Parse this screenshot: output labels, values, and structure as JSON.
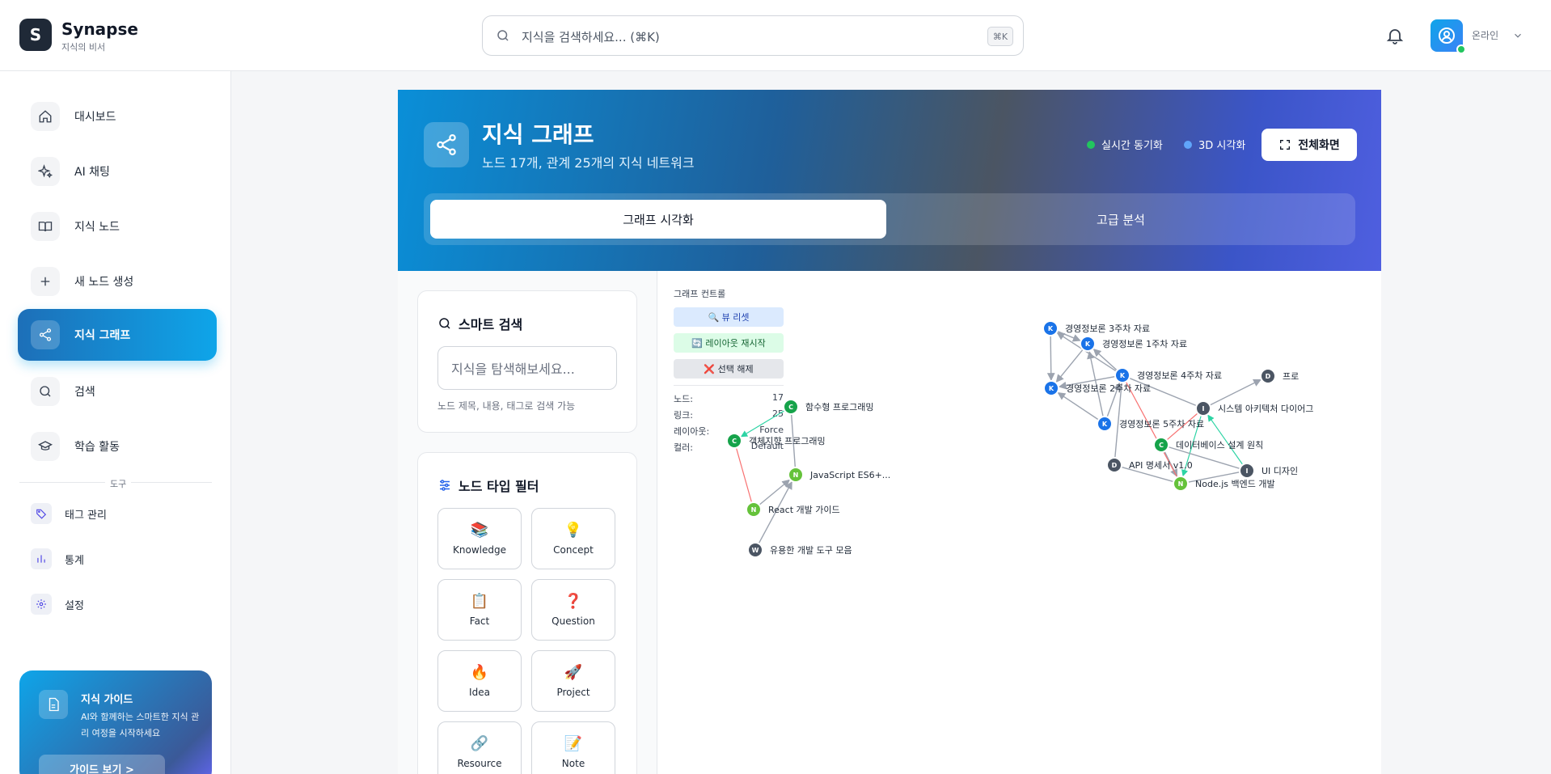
{
  "header": {
    "logo_letter": "S",
    "brand": "Synapse",
    "brand_sub": "지식의 비서",
    "search_placeholder": "지식을 검색하세요... (⌘K)",
    "search_kbd": "⌘K",
    "user_status": "온라인"
  },
  "sidebar": {
    "items": [
      {
        "label": "대시보드",
        "icon": "home-icon"
      },
      {
        "label": "AI 채팅",
        "icon": "sparkles-icon"
      },
      {
        "label": "지식 노드",
        "icon": "book-icon"
      },
      {
        "label": "새 노드 생성",
        "icon": "plus-icon"
      },
      {
        "label": "지식 그래프",
        "icon": "share-icon",
        "active": true
      },
      {
        "label": "검색",
        "icon": "search-icon"
      },
      {
        "label": "학습 활동",
        "icon": "graduation-cap-icon"
      }
    ],
    "tools_label": "도구",
    "tools": [
      {
        "label": "태그 관리",
        "icon": "tag-icon"
      },
      {
        "label": "통계",
        "icon": "bar-chart-icon"
      },
      {
        "label": "설정",
        "icon": "gear-icon"
      }
    ],
    "guide": {
      "title": "지식 가이드",
      "desc": "AI와 함께하는 스마트한 지식 관리 여정을 시작하세요",
      "button": "가이드 보기 >"
    }
  },
  "hero": {
    "title": "지식 그래프",
    "subtitle": "노드 17개, 관계 25개의 지식 네트워크",
    "realtime": "실시간 동기화",
    "viz3d": "3D 시각화",
    "fullscreen": "전체화면",
    "tabs": [
      "그래프 시각화",
      "고급 분석"
    ]
  },
  "smart_search": {
    "title": "스마트 검색",
    "placeholder": "지식을 탐색해보세요...",
    "hint": "노드 제목, 내용, 태그로 검색 가능"
  },
  "type_filter": {
    "title": "노드 타입 필터",
    "types": [
      {
        "label": "Knowledge",
        "emoji": "📚"
      },
      {
        "label": "Concept",
        "emoji": "💡"
      },
      {
        "label": "Fact",
        "emoji": "📋"
      },
      {
        "label": "Question",
        "emoji": "❓"
      },
      {
        "label": "Idea",
        "emoji": "🔥"
      },
      {
        "label": "Project",
        "emoji": "🚀"
      },
      {
        "label": "Resource",
        "emoji": "🔗"
      },
      {
        "label": "Note",
        "emoji": "📝"
      }
    ]
  },
  "graph_controls": {
    "title": "그래프 컨트롤",
    "reset_view": "🔍 뷰 리셋",
    "restart_layout": "🔄 레이아웃 재시작",
    "clear_selection": "❌ 선택 해제",
    "stats": [
      {
        "label": "노드:",
        "value": "17"
      },
      {
        "label": "링크:",
        "value": "25"
      },
      {
        "label": "레이아웃:",
        "value": "Force"
      },
      {
        "label": "컬러:",
        "value": "Default"
      }
    ]
  },
  "graph": {
    "colors": {
      "K": "#1a73e8",
      "C": "#16a34a",
      "N": "#65c23a",
      "W": "#4b5563",
      "D": "#4b5563",
      "I": "#4b5563"
    },
    "nodes": [
      {
        "id": "k3",
        "letter": "K",
        "label": "경영정보론 3주차 자료"
      },
      {
        "id": "k1",
        "letter": "K",
        "label": "경영정보론 1주차 자료"
      },
      {
        "id": "k4",
        "letter": "K",
        "label": "경영정보론 4주차 자료"
      },
      {
        "id": "k2",
        "letter": "K",
        "label": "경영정보론 2주차 자료"
      },
      {
        "id": "k5",
        "letter": "K",
        "label": "경영정보론 5주차 자료"
      },
      {
        "id": "d1",
        "letter": "D",
        "label": "프로"
      },
      {
        "id": "i1",
        "letter": "I",
        "label": "시스템 아키텍처 다이어그"
      },
      {
        "id": "c1",
        "letter": "C",
        "label": "데이터베이스 설계 원칙"
      },
      {
        "id": "d2",
        "letter": "D",
        "label": "API 명세서 v1.0"
      },
      {
        "id": "i2",
        "letter": "I",
        "label": "UI 디자인"
      },
      {
        "id": "n1",
        "letter": "N",
        "label": "Node.js 백엔드 개발"
      },
      {
        "id": "c2",
        "letter": "C",
        "label": "함수형 프로그래밍"
      },
      {
        "id": "c3",
        "letter": "C",
        "label": "객체지향 프로그래밍"
      },
      {
        "id": "n2",
        "letter": "N",
        "label": "JavaScript ES6+..."
      },
      {
        "id": "n3",
        "letter": "N",
        "label": "React 개발 가이드"
      },
      {
        "id": "w1",
        "letter": "W",
        "label": "유용한 개발 도구 모음"
      }
    ],
    "links": [
      {
        "s": "k3",
        "t": "k1",
        "c": "gray",
        "arrow": true
      },
      {
        "s": "k3",
        "t": "k2",
        "c": "gray",
        "arrow": true
      },
      {
        "s": "k1",
        "t": "k2",
        "c": "gray",
        "arrow": true
      },
      {
        "s": "k4",
        "t": "k1",
        "c": "gray",
        "arrow": true
      },
      {
        "s": "k4",
        "t": "k3",
        "c": "gray",
        "arrow": true
      },
      {
        "s": "k4",
        "t": "k2",
        "c": "gray",
        "arrow": true
      },
      {
        "s": "k5",
        "t": "k1",
        "c": "gray",
        "arrow": true
      },
      {
        "s": "k5",
        "t": "k4",
        "c": "gray",
        "arrow": true
      },
      {
        "s": "k5",
        "t": "k2",
        "c": "gray",
        "arrow": true
      },
      {
        "s": "i1",
        "t": "k4",
        "c": "gray",
        "arrow": false
      },
      {
        "s": "i1",
        "t": "d1",
        "c": "gray",
        "arrow": true
      },
      {
        "s": "i1",
        "t": "c1",
        "c": "red",
        "arrow": false
      },
      {
        "s": "i1",
        "t": "n1",
        "c": "green",
        "arrow": true
      },
      {
        "s": "c1",
        "t": "n1",
        "c": "gray",
        "arrow": true
      },
      {
        "s": "d2",
        "t": "n1",
        "c": "gray",
        "arrow": false
      },
      {
        "s": "i2",
        "t": "n1",
        "c": "gray",
        "arrow": false
      },
      {
        "s": "i2",
        "t": "i1",
        "c": "green",
        "arrow": true
      },
      {
        "s": "k4",
        "t": "n1",
        "c": "red",
        "arrow": false
      },
      {
        "s": "d2",
        "t": "k4",
        "c": "gray",
        "arrow": false
      },
      {
        "s": "c2",
        "t": "c3",
        "c": "green",
        "arrow": true
      },
      {
        "s": "c2",
        "t": "n2",
        "c": "gray",
        "arrow": false
      },
      {
        "s": "c3",
        "t": "n3",
        "c": "red",
        "arrow": false
      },
      {
        "s": "n3",
        "t": "n2",
        "c": "gray",
        "arrow": true
      },
      {
        "s": "w1",
        "t": "n2",
        "c": "gray",
        "arrow": true
      },
      {
        "s": "i2",
        "t": "c1",
        "c": "gray",
        "arrow": false
      }
    ]
  }
}
